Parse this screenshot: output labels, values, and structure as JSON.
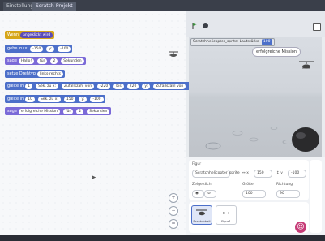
{
  "tabs": [
    "Einstellungen",
    "Scratch-Projekt"
  ],
  "code_blocks": [
    {
      "type": "event",
      "text": "Wenn",
      "pills": [
        "angeklickt wird"
      ]
    },
    {
      "type": "motion",
      "text": "gehe zu x:",
      "pills": [
        "-150",
        "y:",
        "-100"
      ]
    },
    {
      "type": "looks",
      "text": "sage",
      "pills": [
        "Hallo!",
        "für",
        "2",
        "Sekunden"
      ]
    },
    {
      "type": "motion",
      "text": "setze Drehtyp",
      "pills": [
        "links-rechts"
      ]
    },
    {
      "type": "motion",
      "text": "gleite in",
      "pills": [
        "1",
        "Sek. zu x:",
        "Zufallszahl von",
        "-220",
        "bis",
        "220",
        "y:",
        "Zufallszahl von",
        "-160",
        "bis",
        "170"
      ]
    },
    {
      "type": "motion",
      "text": "gleite in",
      "pills": [
        "10",
        "Sek. zu x:",
        "150",
        "y:",
        "-100"
      ]
    },
    {
      "type": "looks",
      "text": "sage",
      "pills": [
        "erfolgreiche Mission",
        "für",
        "2",
        "Sekunden"
      ]
    }
  ],
  "zoom_controls": [
    "+",
    "−",
    "="
  ],
  "stage": {
    "monitor_label": "Scratchhelicopter_sprite: Lautstärke",
    "monitor_value": "100",
    "speech": "erfolgreiche Mission"
  },
  "sprite_info": {
    "sprite_label": "Figur",
    "sprite_name": "Scratchhelicopter_sprite",
    "x_label": "↔ x",
    "x_value": "150",
    "y_label": "↕ y",
    "y_value": "-100",
    "show_label": "Zeige dich",
    "size_label": "Größe",
    "size_value": "100",
    "direction_label": "Richtung",
    "direction_value": "90"
  },
  "sprites": [
    {
      "name": "Scratchheli"
    },
    {
      "name": "Figur1"
    }
  ],
  "colors": {
    "motion": "#4c6fc9",
    "looks": "#7b6ad8",
    "event": "#d6a61a",
    "add": "#c63c77"
  }
}
